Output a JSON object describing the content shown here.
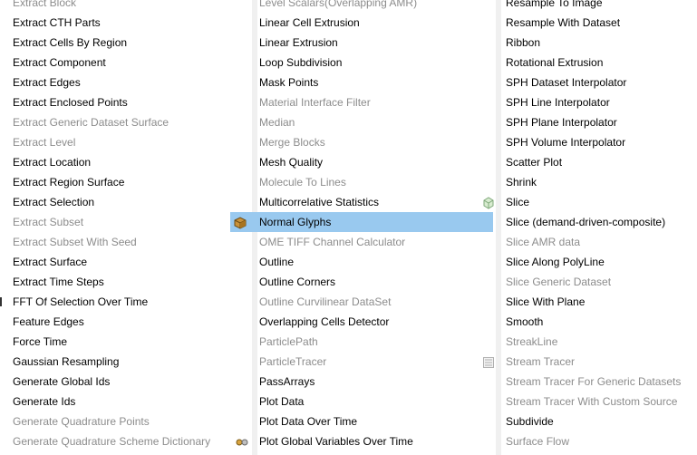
{
  "columns": [
    {
      "items": [
        {
          "label": "Extract Block",
          "disabled": true
        },
        {
          "label": "Extract CTH Parts",
          "disabled": false
        },
        {
          "label": "Extract Cells By Region",
          "disabled": false
        },
        {
          "label": "Extract Component",
          "disabled": false
        },
        {
          "label": "Extract Edges",
          "disabled": false
        },
        {
          "label": "Extract Enclosed Points",
          "disabled": false
        },
        {
          "label": "Extract Generic Dataset Surface",
          "disabled": true
        },
        {
          "label": "Extract Level",
          "disabled": true
        },
        {
          "label": "Extract Location",
          "disabled": false
        },
        {
          "label": "Extract Region Surface",
          "disabled": false
        },
        {
          "label": "Extract Selection",
          "disabled": false
        },
        {
          "label": "Extract Subset",
          "disabled": true
        },
        {
          "label": "Extract Subset With Seed",
          "disabled": true
        },
        {
          "label": "Extract Surface",
          "disabled": false
        },
        {
          "label": "Extract Time Steps",
          "disabled": false
        },
        {
          "label": "FFT Of Selection Over Time",
          "disabled": false
        },
        {
          "label": "Feature Edges",
          "disabled": false
        },
        {
          "label": "Force Time",
          "disabled": false
        },
        {
          "label": "Gaussian Resampling",
          "disabled": false
        },
        {
          "label": "Generate Global Ids",
          "disabled": false
        },
        {
          "label": "Generate Ids",
          "disabled": false
        },
        {
          "label": "Generate Quadrature Points",
          "disabled": true
        },
        {
          "label": "Generate Quadrature Scheme Dictionary",
          "disabled": true
        }
      ]
    },
    {
      "items": [
        {
          "label": "Level Scalars(Overlapping AMR)",
          "disabled": true
        },
        {
          "label": "Linear Cell Extrusion",
          "disabled": false
        },
        {
          "label": "Linear Extrusion",
          "disabled": false
        },
        {
          "label": "Loop Subdivision",
          "disabled": false
        },
        {
          "label": "Mask Points",
          "disabled": false
        },
        {
          "label": "Material Interface Filter",
          "disabled": true
        },
        {
          "label": "Median",
          "disabled": true
        },
        {
          "label": "Merge Blocks",
          "disabled": true
        },
        {
          "label": "Mesh Quality",
          "disabled": false
        },
        {
          "label": "Molecule To Lines",
          "disabled": true
        },
        {
          "label": "Multicorrelative Statistics",
          "disabled": false
        },
        {
          "label": "Normal Glyphs",
          "disabled": false,
          "selected": true
        },
        {
          "label": "OME TIFF Channel Calculator",
          "disabled": true
        },
        {
          "label": "Outline",
          "disabled": false
        },
        {
          "label": "Outline Corners",
          "disabled": false
        },
        {
          "label": "Outline Curvilinear DataSet",
          "disabled": true
        },
        {
          "label": "Overlapping Cells Detector",
          "disabled": false
        },
        {
          "label": "ParticlePath",
          "disabled": true
        },
        {
          "label": "ParticleTracer",
          "disabled": true
        },
        {
          "label": "PassArrays",
          "disabled": false
        },
        {
          "label": "Plot Data",
          "disabled": false
        },
        {
          "label": "Plot Data Over Time",
          "disabled": false
        },
        {
          "label": "Plot Global Variables Over Time",
          "disabled": false
        }
      ]
    },
    {
      "items": [
        {
          "label": "Resample To Image",
          "disabled": false
        },
        {
          "label": "Resample With Dataset",
          "disabled": false
        },
        {
          "label": "Ribbon",
          "disabled": false
        },
        {
          "label": "Rotational Extrusion",
          "disabled": false
        },
        {
          "label": "SPH Dataset Interpolator",
          "disabled": false
        },
        {
          "label": "SPH Line Interpolator",
          "disabled": false
        },
        {
          "label": "SPH Plane Interpolator",
          "disabled": false
        },
        {
          "label": "SPH Volume Interpolator",
          "disabled": false
        },
        {
          "label": "Scatter Plot",
          "disabled": false
        },
        {
          "label": "Shrink",
          "disabled": false
        },
        {
          "label": "Slice",
          "disabled": false
        },
        {
          "label": "Slice (demand-driven-composite)",
          "disabled": false
        },
        {
          "label": "Slice AMR data",
          "disabled": true
        },
        {
          "label": "Slice Along PolyLine",
          "disabled": false
        },
        {
          "label": "Slice Generic Dataset",
          "disabled": true
        },
        {
          "label": "Slice With Plane",
          "disabled": false
        },
        {
          "label": "Smooth",
          "disabled": false
        },
        {
          "label": "StreakLine",
          "disabled": true
        },
        {
          "label": "Stream Tracer",
          "disabled": true
        },
        {
          "label": "Stream Tracer For Generic Datasets",
          "disabled": true
        },
        {
          "label": "Stream Tracer With Custom Source",
          "disabled": true
        },
        {
          "label": "Subdivide",
          "disabled": false
        },
        {
          "label": "Surface Flow",
          "disabled": true
        }
      ]
    }
  ],
  "icons": {
    "normal_glyphs": "cube-glyph-icon",
    "slice": "slice-cube-icon",
    "stream_tracer": "stream-tracer-icon",
    "quadrature_dictionary": "quadrature-icon"
  },
  "colors": {
    "selection": "#99c9ef",
    "disabled_text": "#8c8c8c"
  }
}
